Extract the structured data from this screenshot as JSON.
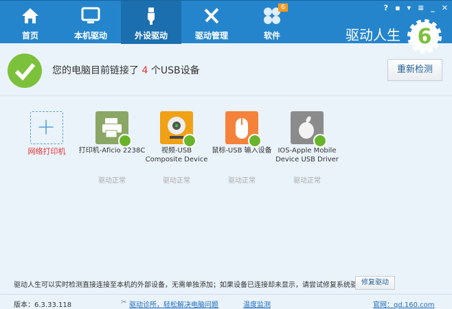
{
  "header": {
    "tabs": [
      {
        "label": "首页",
        "icon": "home-icon"
      },
      {
        "label": "本机驱动",
        "icon": "monitor-icon"
      },
      {
        "label": "外设驱动",
        "icon": "usb-icon",
        "active": true
      },
      {
        "label": "驱动管理",
        "icon": "tools-icon"
      },
      {
        "label": "软件",
        "icon": "apps-icon",
        "badge": "6"
      }
    ],
    "window_buttons": [
      "?",
      "▪",
      "▾",
      "≡",
      "_",
      "✕"
    ],
    "brand": "驱动人生",
    "logo_text": "6"
  },
  "status": {
    "prefix": "您的电脑目前链接了 ",
    "count": "4",
    "suffix": " 个USB设备",
    "rescan_label": "重新检测"
  },
  "add_printer": {
    "label": "网络打印机"
  },
  "devices": [
    {
      "name": "打印机-Aficio 2238C",
      "status": "驱动正常",
      "color": "#8aa765"
    },
    {
      "name": "视频-USB Composite Device",
      "status": "驱动正常",
      "color": "#f0a116"
    },
    {
      "name": "鼠标-USB 输入设备",
      "status": "驱动正常",
      "color": "#f5823a"
    },
    {
      "name": "IOS-Apple Mobile Device USB Driver",
      "status": "驱动正常",
      "color": "#8b8b8b"
    }
  ],
  "bottom": {
    "text": "驱动人生可以实时检测直接连接至本机的外部设备，无需单独添加；如果设备已连接却未显示，请尝试修复系统驱动:",
    "repair_label": "修复驱动"
  },
  "footer": {
    "version": "版本：6.3.33.118",
    "diagnose": "驱动诊所，轻松解决电脑问题",
    "temp": "温度监测",
    "site": "官网：qd.160.com"
  }
}
